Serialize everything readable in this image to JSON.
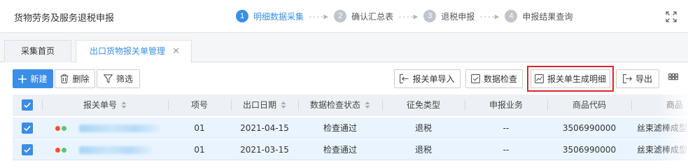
{
  "header": {
    "title": "货物劳务及服务退税申报",
    "steps": [
      {
        "num": "1",
        "label": "明细数据采集"
      },
      {
        "num": "2",
        "label": "确认汇总表"
      },
      {
        "num": "3",
        "label": "退税申报"
      },
      {
        "num": "4",
        "label": "申报结果查询"
      }
    ],
    "step_arrow": "----▶"
  },
  "tabs": [
    {
      "label": "采集首页"
    },
    {
      "label": "出口货物报关单管理",
      "close": "✕"
    }
  ],
  "toolbar": {
    "new": "新建",
    "delete": "删除",
    "filter": "筛选",
    "import": "报关单导入",
    "check": "数据检查",
    "generate": "报关单生成明细",
    "export": "导出"
  },
  "table": {
    "columns": [
      "报关单号",
      "项号",
      "出口日期",
      "数据检查状态",
      "征免类型",
      "申报业务",
      "商品代码",
      "商品"
    ],
    "rows": [
      {
        "item_no": "01",
        "export_date": "2021-04-15",
        "check_status": "检查通过",
        "exemption_type": "退税",
        "business": "--",
        "product_code": "3506990000",
        "product_name": "丝束滤棒成型"
      },
      {
        "item_no": "01",
        "export_date": "2021-03-15",
        "check_status": "检查通过",
        "exemption_type": "退税",
        "business": "--",
        "product_code": "3506990000",
        "product_name": "丝束滤棒成型"
      }
    ]
  },
  "colors": {
    "accent": "#3a8ee6",
    "highlight": "#d9232d",
    "status_red": "#f0522e",
    "status_green": "#5cc46b"
  }
}
